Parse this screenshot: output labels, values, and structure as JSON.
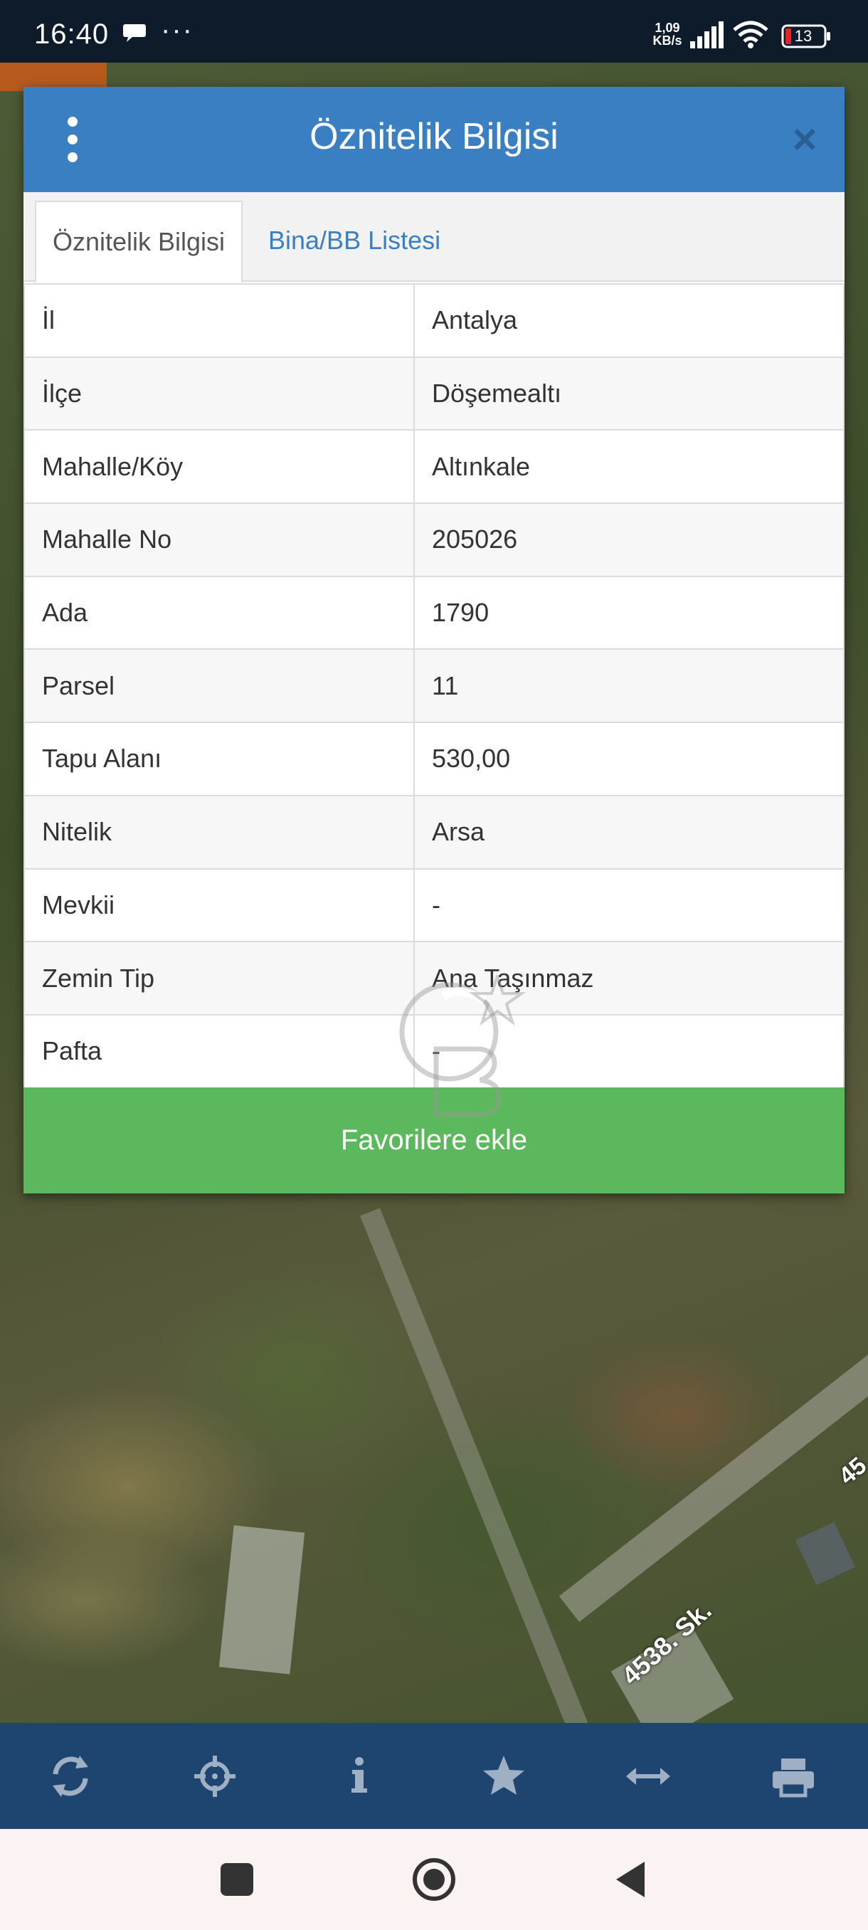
{
  "status_bar": {
    "time": "16:40",
    "more_dots": "···",
    "net_speed_value": "1,09",
    "net_speed_unit": "KB/s",
    "battery_level": "13"
  },
  "map": {
    "road_label": "4538. Sk.",
    "edge_label": "45"
  },
  "dialog": {
    "title": "Öznitelik Bilgisi",
    "close_label": "×",
    "tabs": [
      {
        "label": "Öznitelik Bilgisi",
        "active": true
      },
      {
        "label": "Bina/BB Listesi",
        "active": false
      }
    ],
    "rows": [
      {
        "label": "İl",
        "value": "Antalya"
      },
      {
        "label": "İlçe",
        "value": "Döşemealtı"
      },
      {
        "label": "Mahalle/Köy",
        "value": "Altınkale"
      },
      {
        "label": "Mahalle No",
        "value": "205026"
      },
      {
        "label": "Ada",
        "value": "1790"
      },
      {
        "label": "Parsel",
        "value": "11"
      },
      {
        "label": "Tapu Alanı",
        "value": "530,00"
      },
      {
        "label": "Nitelik",
        "value": "Arsa"
      },
      {
        "label": "Mevkii",
        "value": "-"
      },
      {
        "label": "Zemin Tip",
        "value": "Ana Taşınmaz"
      },
      {
        "label": "Pafta",
        "value": "-"
      }
    ],
    "favorite_button": "Favorilere ekle"
  },
  "toolbar": {
    "icons": [
      "refresh-icon",
      "crosshair-icon",
      "info-icon",
      "star-icon",
      "measure-icon",
      "print-icon"
    ]
  },
  "nav_bar": {
    "icons": [
      "recents-icon",
      "home-icon",
      "back-icon"
    ]
  },
  "colors": {
    "header_blue": "#3a7fc1",
    "favorite_green": "#5cb85c",
    "toolbar_blue": "#1e4470",
    "toolbar_icon": "#9fb0c4"
  }
}
